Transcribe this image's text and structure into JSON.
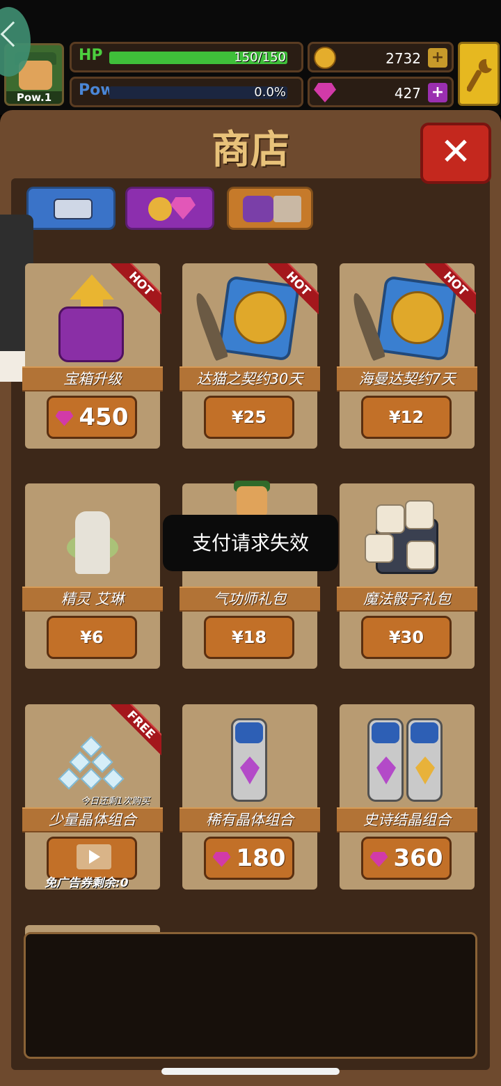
{
  "hud": {
    "player_level": "Pow.1",
    "hp_label": "HP",
    "hp_text": "150/150",
    "hp_fraction": 1.0,
    "pow_label": "Pow",
    "pow_text": "0.0%",
    "pow_fraction": 0.0,
    "gold": "2732",
    "gems": "427",
    "plus": "+"
  },
  "shop": {
    "title": "商店",
    "close": "✕",
    "tabs": [
      "equipment",
      "currency",
      "items"
    ]
  },
  "items": [
    {
      "label": "宝箱升级",
      "price": "450",
      "price_type": "gem",
      "badge": "HOT"
    },
    {
      "label": "达猫之契约30天",
      "price": "¥25",
      "price_type": "cash",
      "badge": "HOT"
    },
    {
      "label": "海曼达契约7天",
      "price": "¥12",
      "price_type": "cash",
      "badge": "HOT"
    },
    {
      "label": "精灵 艾琳",
      "price": "¥6",
      "price_type": "cash",
      "badge": ""
    },
    {
      "label": "气功师礼包",
      "price": "¥18",
      "price_type": "cash",
      "badge": ""
    },
    {
      "label": "魔法骰子礼包",
      "price": "¥30",
      "price_type": "cash",
      "badge": ""
    },
    {
      "label": "少量晶体组合",
      "price": "",
      "price_type": "ad",
      "badge": "FREE",
      "note": "今日还剩1次购买",
      "ad_note": "免广告券剩余:0"
    },
    {
      "label": "稀有晶体组合",
      "price": "180",
      "price_type": "gem",
      "badge": ""
    },
    {
      "label": "史诗结晶组合",
      "price": "360",
      "price_type": "gem",
      "badge": ""
    }
  ],
  "toast": "支付请求失效",
  "colors": {
    "panel": "#6e4a2e",
    "card": "#b89b72",
    "button": "#c27028",
    "close": "#c4281e",
    "hp": "#3fbf3a"
  }
}
